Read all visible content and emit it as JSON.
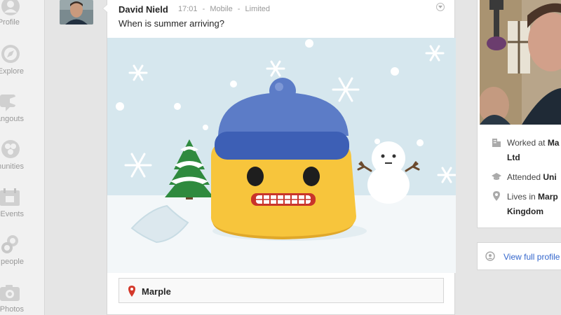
{
  "nav": {
    "items": [
      {
        "label": "Profile",
        "icon": "profile-icon"
      },
      {
        "label": "Explore",
        "icon": "explore-icon"
      },
      {
        "label": "angouts",
        "icon": "hangouts-icon"
      },
      {
        "label": "mmunities",
        "icon": "communities-icon"
      },
      {
        "label": "Events",
        "icon": "events-icon"
      },
      {
        "label": "d people",
        "icon": "find-people-icon"
      },
      {
        "label": "Photos",
        "icon": "photos-icon"
      }
    ]
  },
  "post": {
    "author": "David Nield",
    "time": "17:01",
    "source": "Mobile",
    "visibility": "Limited",
    "separator": "-",
    "text": "When is summer arriving?",
    "location": "Marple"
  },
  "profile": {
    "worked_label": "Worked at",
    "worked_value_1": "Ma",
    "worked_value_2": "Ltd",
    "attended_label": "Attended",
    "attended_value": "Uni",
    "lives_label": "Lives in",
    "lives_value_1": "Marp",
    "lives_value_2": "Kingdom",
    "view_full": "View full profile"
  },
  "colors": {
    "link": "#3366cc",
    "hat": "#5c7cc7",
    "hat_band": "#3d5fb5",
    "face": "#f7c53c",
    "sky": "#d6e7ee",
    "snow": "#f3f7f9",
    "pin": "#d4392b"
  }
}
